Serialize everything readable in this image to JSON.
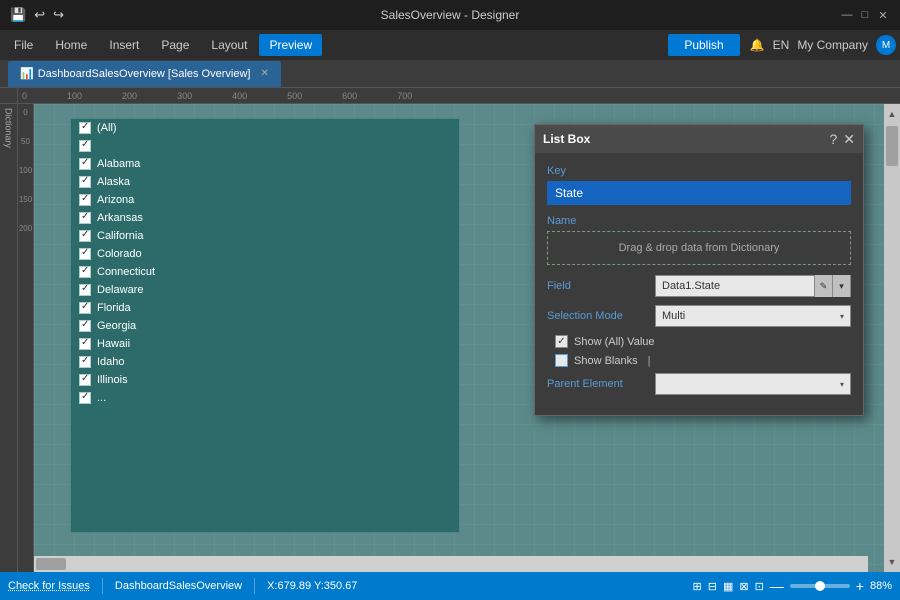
{
  "titleBar": {
    "title": "SalesOverview - Designer",
    "controls": [
      "—",
      "□",
      "✕"
    ]
  },
  "toolbar": {
    "saveIcon": "💾",
    "undoIcon": "↩",
    "redoIcon": "↪",
    "items": [
      "File",
      "Home",
      "Insert",
      "Page",
      "Layout",
      "Preview"
    ],
    "activeItem": "Preview",
    "publishLabel": "Publish",
    "bellIcon": "🔔",
    "langLabel": "EN",
    "companyLabel": "My Company"
  },
  "tabBar": {
    "icon": "📊",
    "tabLabel": "DashboardSalesOverview [Sales Overview]"
  },
  "listbox": {
    "items": [
      "(All)",
      "",
      "Alabama",
      "Alaska",
      "Arizona",
      "Arkansas",
      "California",
      "Colorado",
      "Connecticut",
      "Delaware",
      "Florida",
      "Georgia",
      "Hawaii",
      "Idaho",
      "Illinois",
      "..."
    ]
  },
  "dialog": {
    "title": "List Box",
    "helpBtn": "?",
    "closeBtn": "✕",
    "keyLabel": "Key",
    "keyValue": "State",
    "nameLabel": "Name",
    "dragDropText": "Drag & drop data from Dictionary",
    "fieldLabel": "Field",
    "fieldValue": "Data1.State",
    "selectionModeLabel": "Selection Mode",
    "selectionModeValue": "Multi",
    "showAllValue": "Show (All) Value",
    "showBlanks": "Show Blanks",
    "parentElementLabel": "Parent Element",
    "parentElementValue": ""
  },
  "statusBar": {
    "checkIssues": "Check for Issues",
    "tabName": "DashboardSalesOverview",
    "coords": "X:679.89 Y:350.67",
    "zoomLabel": "88%",
    "icons": [
      "⊞",
      "⊟",
      "▦",
      "⊠",
      "⊡"
    ]
  }
}
